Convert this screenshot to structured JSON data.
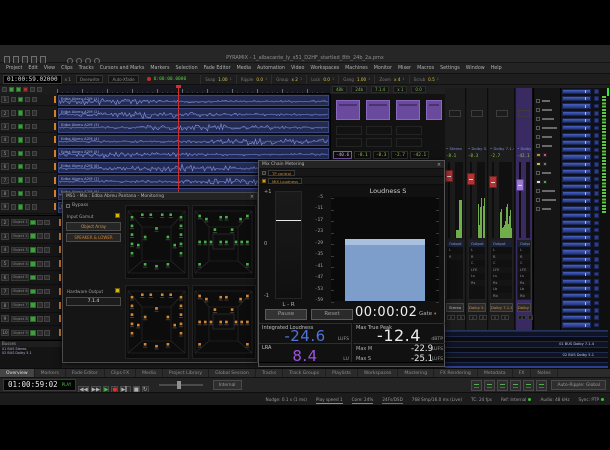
{
  "app": {
    "title": "PYRAMIX - 1_albacante_ly_s51_D2HF_startled_8th_24b_2a.pmx",
    "menus": [
      "Project",
      "Edit",
      "View",
      "Clips",
      "Tracks",
      "Cursors and Marks",
      "Markers",
      "Selection",
      "Fade Editor",
      "Media",
      "Automation",
      "Video",
      "Workspaces",
      "Machines",
      "Monitor",
      "Mixer",
      "Macros",
      "Settings",
      "Window",
      "Help"
    ]
  },
  "toolbar": {
    "timecode": "01:00:59.02000",
    "mult": "x 1",
    "mode_field": "Overwrite",
    "xfade_field": "Auto-Xfade",
    "rec_time": "0:00:00.0000",
    "groups": [
      {
        "label": "Snap",
        "value": "1.00",
        "sub": "1"
      },
      {
        "label": "Ripple",
        "value": "0.0",
        "sub": "1"
      },
      {
        "label": "Group",
        "value": "x 2",
        "sub": "1"
      },
      {
        "label": "Lock",
        "value": "0.0",
        "sub": "1"
      },
      {
        "label": "Gang",
        "value": "1.00",
        "sub": "1"
      },
      {
        "label": "Zoom",
        "value": "x 4",
        "sub": "1"
      },
      {
        "label": "Scrub",
        "value": "0.5",
        "sub": "1"
      }
    ],
    "row2_fields": [
      "48k",
      "24b",
      "7.1.4",
      "x 1",
      "0.0"
    ]
  },
  "tracks": {
    "clips": [
      "Edba Abreu A2M (1)",
      "Edba Abreu A2M (2)",
      "Edba Abreu A2M (3)",
      "Edba Abreu A2M (4)",
      "Edba Abreu A2M (5)",
      "Edba Abreu A2M (6)",
      "Edba Abreu A2M (7)",
      "Edba Abreu A2M (8)",
      "Edba Abreu A2M (9)"
    ]
  },
  "tracklist": {
    "rows": [
      {
        "num": "2",
        "name": "Object 1"
      },
      {
        "num": "3",
        "name": "Object 2"
      },
      {
        "num": "4",
        "name": "Object 3"
      },
      {
        "num": "5",
        "name": "Object 4"
      },
      {
        "num": "6",
        "name": "Object 5"
      },
      {
        "num": "7",
        "name": "Object 6"
      },
      {
        "num": "8",
        "name": "Object 7"
      },
      {
        "num": "9",
        "name": "Object 8"
      },
      {
        "num": "10",
        "name": "Object 9"
      }
    ]
  },
  "busses_left": {
    "header": "Busses",
    "rows": [
      "01 BUS Stereo",
      "02 BUS Dolby 5.1",
      "",
      "",
      ""
    ]
  },
  "busses_right": {
    "rows": [
      "",
      "",
      "01 BUS Dolby 7.1.4",
      "",
      "02 BUS Dolby 5.1",
      "",
      ""
    ]
  },
  "meters": {
    "readouts": [
      "-40.6",
      "-8.1",
      "-8.3",
      "-2.7",
      "-42.1"
    ]
  },
  "mixer": {
    "routing_header": "Output",
    "routing_channels": [
      "L",
      "R",
      "C",
      "LFE",
      "Ls",
      "Rs",
      "Lb",
      "Rb"
    ],
    "strips": [
      {
        "name": "Stereo",
        "name_color": "#b8b8b8",
        "value": "-8.1",
        "channels": 2,
        "selected": false
      },
      {
        "name": "Dolby 5.1",
        "name_color": "#d09040",
        "value": "-8.3",
        "channels": 6,
        "selected": false
      },
      {
        "name": "Dolby 7.1.4",
        "name_color": "#d09040",
        "value": "-2.7",
        "channels": 12,
        "selected": false
      },
      {
        "name": "Dolby 7.1.4",
        "name_color": "#e09040",
        "value": "-42.1",
        "channels": 12,
        "selected": true
      }
    ]
  },
  "monitoring": {
    "title": "MS1 - Mix : Edba Abreu Pantana - Monitoring",
    "close": "×",
    "bypass": "Bypass",
    "input_label": "Input Gamut",
    "object_button": "Object Array",
    "speaker_button": "SPEAKER & LOWER",
    "output_label": "Hardware Output",
    "output_value": "7.1.4"
  },
  "loudness": {
    "title": "Mix Chain Metering",
    "close": "×",
    "sources": [
      {
        "label": "TP control"
      },
      {
        "label": "MIX Loudness"
      }
    ],
    "corr": {
      "top": "+1",
      "mid": "0",
      "bottom": "-1",
      "label": "L - R"
    },
    "scale": [
      "-5",
      "-11",
      "-17",
      "-23",
      "-29",
      "-35",
      "-41",
      "-47",
      "-53",
      "-59"
    ],
    "chart_title": "Loudness S",
    "pause": "Pause",
    "reset": "Reset",
    "time": "00:00:02",
    "gate": "Gate",
    "gate_arrow": "▾",
    "integrated": {
      "label": "Integrated Loudness",
      "value": "-24.6",
      "unit": "LUFS"
    },
    "lra": {
      "label": "LRA",
      "value": "8.4",
      "unit": "LU"
    },
    "mtp": {
      "label": "Max True Peak",
      "value": "-12.4",
      "unit": "dBTP"
    },
    "maxm": {
      "label": "Max M",
      "value": "-22.9",
      "unit": "LUFS"
    },
    "maxs": {
      "label": "Max S",
      "value": "-25.1",
      "unit": "LUFS"
    }
  },
  "chart_data": {
    "type": "bar",
    "title": "Loudness S",
    "categories": [
      "S"
    ],
    "values": [
      -27
    ],
    "ylabel": "LUFS",
    "ylim": [
      -59,
      -5
    ],
    "yticks": [
      -5,
      -11,
      -17,
      -23,
      -29,
      -35,
      -41,
      -47,
      -53,
      -59
    ],
    "bar_color": "#7d9dca",
    "grid": false,
    "legend": "none"
  },
  "tabs": {
    "active": "Overview",
    "items": [
      "Overview",
      "Markers",
      "Fade Editor",
      "Clips FX",
      "Media",
      "Project Library",
      "Global Session",
      "Tracks",
      "Track Groups",
      "Playlists",
      "Workspaces",
      "Mastering",
      "FX Rendering",
      "Metadata",
      "FX",
      "Notes"
    ]
  },
  "transport": {
    "timecode": "01:00:59:02",
    "state": "PLAY",
    "internal": "Internal",
    "ripple": "Auto-Ripple: Global",
    "buttons": [
      "◀◀",
      "▶▶",
      "▶",
      "●",
      "▶▎",
      "■",
      "↻"
    ]
  },
  "status": {
    "items": [
      {
        "text": "Nudge: 0.1 s (1 ms)"
      },
      {
        "text": "Play speed 1",
        "accent": "#c87f32"
      },
      {
        "text": "Core: 24%",
        "accent": "#3fae3f"
      },
      {
        "text": "24Fs/DSD",
        "accent": "#3f6fd8"
      },
      {
        "text": "768 Smp/16.0 ms (Live)"
      },
      {
        "text": "TC: 24 fps"
      },
      {
        "text": "Ref: Internal",
        "dot": "#35c435"
      },
      {
        "text": "Audio: 48 kHz"
      },
      {
        "text": "Sync: PTP",
        "dot": "#35c435"
      }
    ]
  },
  "colors": {
    "accent_blue": "#4f74d8",
    "accent_purple": "#9a55e0",
    "meter_green": "#6fae4a",
    "bridge_blue": "#3350a8",
    "fader_red": "#b03434",
    "clip_blue": "#232b52",
    "playhead_red": "#d23030",
    "room_green": "#49b04a",
    "room_orange": "#d08838"
  }
}
